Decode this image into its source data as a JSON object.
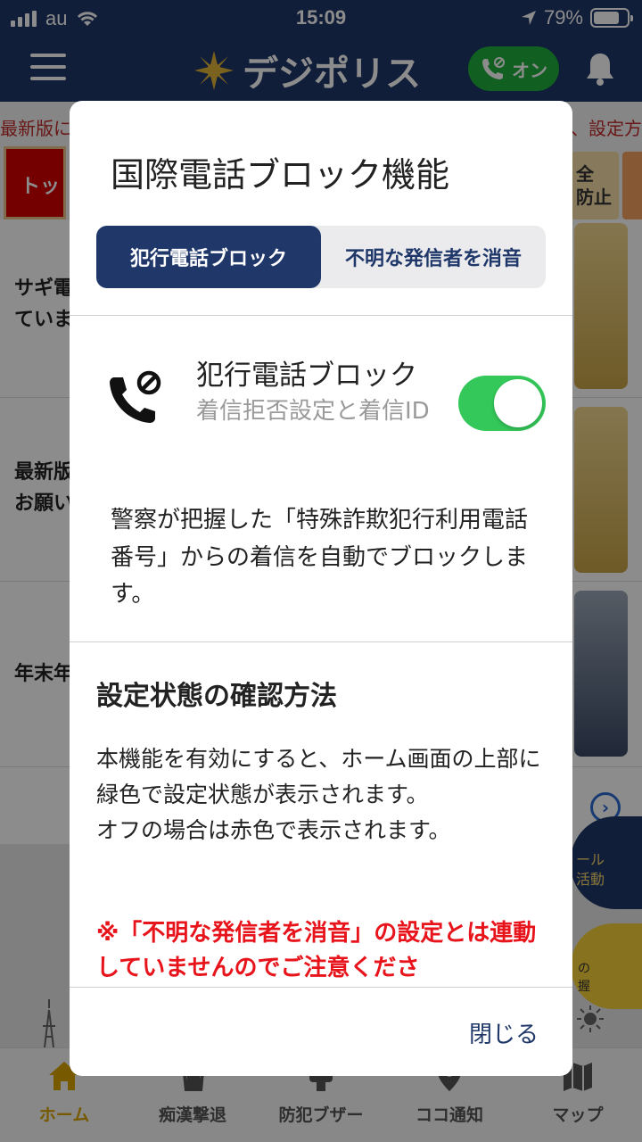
{
  "status_bar": {
    "carrier": "au",
    "time": "15:09",
    "battery": "79%",
    "battery_level": 0.79
  },
  "header": {
    "app_name": "デジポリス",
    "status_pill": "オン",
    "accent_color": "#1f3769",
    "on_color": "#1fae3c"
  },
  "background": {
    "notice_left": "最新版に",
    "notice_right": "、設定方",
    "tab_top": "トッ",
    "tab_right": "全\n防止",
    "items": [
      {
        "text": "サギ電\nていま"
      },
      {
        "text": "最新版\nお願い"
      },
      {
        "text": "年末年"
      }
    ],
    "fab_blue": "ール\n活動",
    "fab_yellow": "の\n握"
  },
  "bottom_nav": {
    "items": [
      {
        "label": "ホーム",
        "icon": "home-icon"
      },
      {
        "label": "痴漢撃退",
        "icon": "hand-icon"
      },
      {
        "label": "防犯ブザー",
        "icon": "buzzer-icon"
      },
      {
        "label": "ココ通知",
        "icon": "location-pin-icon"
      },
      {
        "label": "マップ",
        "icon": "map-icon"
      }
    ]
  },
  "modal": {
    "title": "国際電話ブロック機能",
    "segments": [
      "犯行電話ブロック",
      "不明な発信者を消音"
    ],
    "selected_segment": "犯行電話ブロック",
    "row_title": "犯行電話ブロック",
    "row_subtitle": "着信拒否設定と着信ID",
    "toggle_on": true,
    "toggle_color": "#34c759",
    "description": "警察が把握した「特殊詐欺犯行利用電話番号」からの着信を自動でブロックします。",
    "section_heading": "設定状態の確認方法",
    "section_body": "本機能を有効にすると、ホーム画面の上部に緑色で設定状態が表示されます。\nオフの場合は赤色で表示されます。",
    "warning": "※「不明な発信者を消音」の設定とは連動していませんのでご注意くださ",
    "warning_color": "#e8141c",
    "close_label": "閉じる"
  }
}
